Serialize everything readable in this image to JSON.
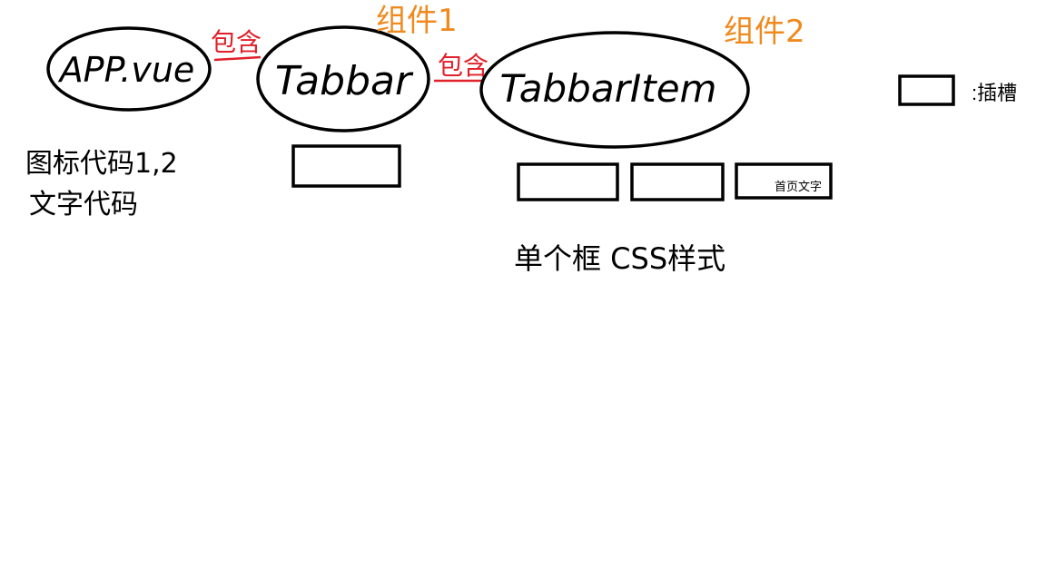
{
  "nodes": {
    "app": "APP.vue",
    "tabbar": "Tabbar",
    "tabbar_item": "TabbarItem"
  },
  "edges": {
    "app_to_tabbar": "包含",
    "tabbar_to_item": "包含"
  },
  "component_tags": {
    "tabbar": "组件1",
    "tabbar_item": "组件2"
  },
  "notes": {
    "app_line1": "图标代码1,2",
    "app_line2": "文字代码",
    "item_note": "单个框 CSS样式"
  },
  "slot_labels": {
    "item_slot3": "首页文字"
  },
  "legend": {
    "slot_label": ":插槽"
  },
  "colors": {
    "ink": "#000000",
    "edge_label": "#e0202a",
    "component_tag": "#f08a1e"
  }
}
